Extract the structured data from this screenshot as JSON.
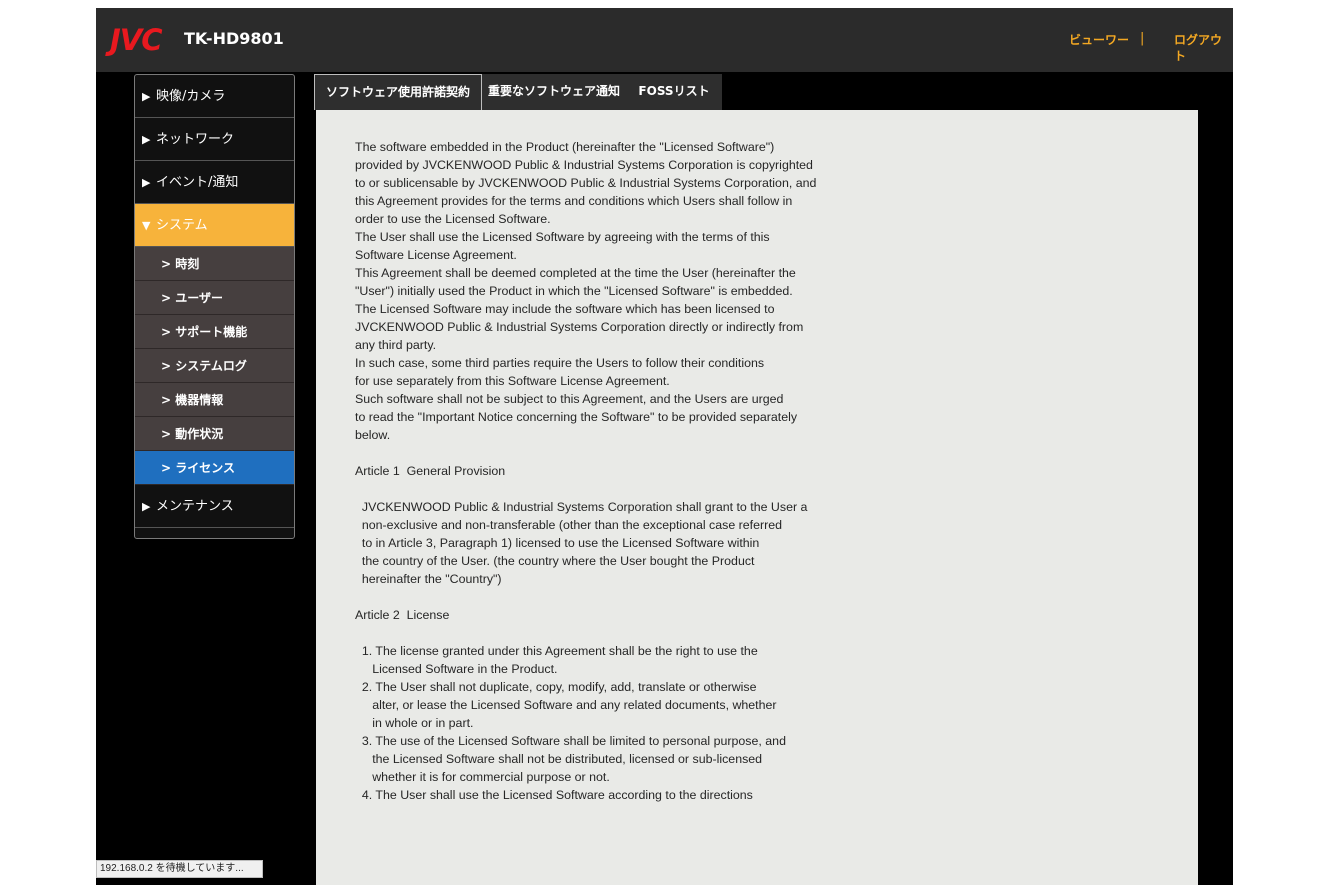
{
  "header": {
    "brand": "JVC",
    "model": "TK-HD9801",
    "viewer_link": "ビューワー",
    "separator": "|",
    "logout_link": "ログアウト"
  },
  "colors": {
    "brand_red": "#e8191f",
    "accent_orange": "#f7b33b",
    "selected_blue": "#1f6fbf",
    "link_orange": "#f3a823"
  },
  "sidebar": {
    "main_items": [
      {
        "label": "映像/カメラ",
        "icon": "triangle-right-icon"
      },
      {
        "label": "ネットワーク",
        "icon": "triangle-right-icon"
      },
      {
        "label": "イベント/通知",
        "icon": "triangle-right-icon"
      },
      {
        "label": "システム",
        "icon": "triangle-down-icon"
      }
    ],
    "sub_items": [
      {
        "label": "> 時刻"
      },
      {
        "label": "> ユーザー"
      },
      {
        "label": "> サポート機能"
      },
      {
        "label": "> システムログ"
      },
      {
        "label": "> 機器情報"
      },
      {
        "label": "> 動作状況"
      },
      {
        "label": "> ライセンス"
      }
    ],
    "after_items": [
      {
        "label": "メンテナンス",
        "icon": "triangle-right-icon"
      }
    ]
  },
  "tabs": [
    {
      "label": "ソフトウェア使用許諾契約",
      "active": true
    },
    {
      "label": "重要なソフトウェア通知",
      "active": false
    },
    {
      "label": "FOSSリスト",
      "active": false
    }
  ],
  "document": {
    "lines": [
      "The software embedded in the Product (hereinafter the \"Licensed Software\")",
      "provided by JVCKENWOOD Public & Industrial Systems Corporation is copyrighted",
      "to or sublicensable by JVCKENWOOD Public & Industrial Systems Corporation, and",
      "this Agreement provides for the terms and conditions which Users shall follow in",
      "order to use the Licensed Software.",
      "The User shall use the Licensed Software by agreeing with the terms of this",
      "Software License Agreement.",
      "This Agreement shall be deemed completed at the time the User (hereinafter the",
      "\"User\") initially used the Product in which the \"Licensed Software\" is embedded.",
      "The Licensed Software may include the software which has been licensed to",
      "JVCKENWOOD Public & Industrial Systems Corporation directly or indirectly from",
      "any third party.",
      "In such case, some third parties require the Users to follow their conditions",
      "for use separately from this Software License Agreement.",
      "Such software shall not be subject to this Agreement, and the Users are urged",
      "to read the \"Important Notice concerning the Software\" to be provided separately",
      "below.",
      "",
      "Article 1  General Provision",
      "",
      "  JVCKENWOOD Public & Industrial Systems Corporation shall grant to the User a",
      "  non-exclusive and non-transferable (other than the exceptional case referred",
      "  to in Article 3, Paragraph 1) licensed to use the Licensed Software within",
      "  the country of the User. (the country where the User bought the Product",
      "  hereinafter the \"Country\")",
      "",
      "Article 2  License",
      "",
      "  1. The license granted under this Agreement shall be the right to use the",
      "     Licensed Software in the Product.",
      "  2. The User shall not duplicate, copy, modify, add, translate or otherwise",
      "     alter, or lease the Licensed Software and any related documents, whether",
      "     in whole or in part.",
      "  3. The use of the Licensed Software shall be limited to personal purpose, and",
      "     the Licensed Software shall not be distributed, licensed or sub-licensed",
      "     whether it is for commercial purpose or not.",
      "  4. The User shall use the Licensed Software according to the directions"
    ]
  },
  "statusbar": {
    "text": "192.168.0.2 を待機しています..."
  }
}
